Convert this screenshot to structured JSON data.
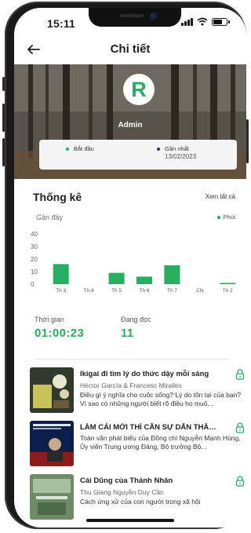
{
  "status_bar": {
    "time": "15:11"
  },
  "header": {
    "title": "Chi tiết"
  },
  "profile": {
    "avatar_letter": "R",
    "name": "Admin",
    "start_label": "Bắt đầu",
    "latest_label": "Gần nhất",
    "latest_date": "13/02/2023"
  },
  "stats": {
    "title": "Thống kê",
    "see_all": "Xem tất cả",
    "recent": "Gần đây",
    "legend": "Phút",
    "time_label": "Thời gian",
    "time_value": "01:00:23",
    "reading_label": "Đang đọc",
    "reading_value": "11"
  },
  "chart_data": {
    "type": "bar",
    "categories": [
      "Th 3",
      "Th 4",
      "Th 5",
      "Th 6",
      "Th 7",
      "CN",
      "Th 2"
    ],
    "values": [
      16,
      0,
      9,
      6,
      15,
      0,
      1
    ],
    "ylim": [
      0,
      40
    ],
    "yticks": [
      "40",
      "30",
      "20",
      "10",
      "0"
    ],
    "grid": false,
    "color": "#27ae60"
  },
  "books": [
    {
      "title": "Ikigai đi tìm lý do thức dậy mỗi sáng",
      "author": "Héctor García & Francesc Miralles",
      "desc": "Điều gì ý nghĩa cho cuộc sống? Lý do tồn tại của bạn? Vì sao có những người biết rõ điều họ muố..."
    },
    {
      "title": "LÀM CÁI MỚI THÌ CẦN SỰ DẤN THÂN Đ...",
      "author": "",
      "desc": "Toàn văn phát biểu của Đồng chí Nguyễn Mạnh Hùng, Ủy viên Trung ương Đảng, Bộ trưởng Bộ..."
    },
    {
      "title": "Cái Dũng của Thánh Nhân",
      "author": "Thu Giang Nguyễn Duy Cần",
      "desc": "Cách ứng xử của con người trong xã hội"
    }
  ],
  "colors": {
    "accent": "#27ae60",
    "text": "#1f1f1f"
  },
  "icons": {
    "back": "arrow-left-icon",
    "lock": "lock-icon"
  }
}
